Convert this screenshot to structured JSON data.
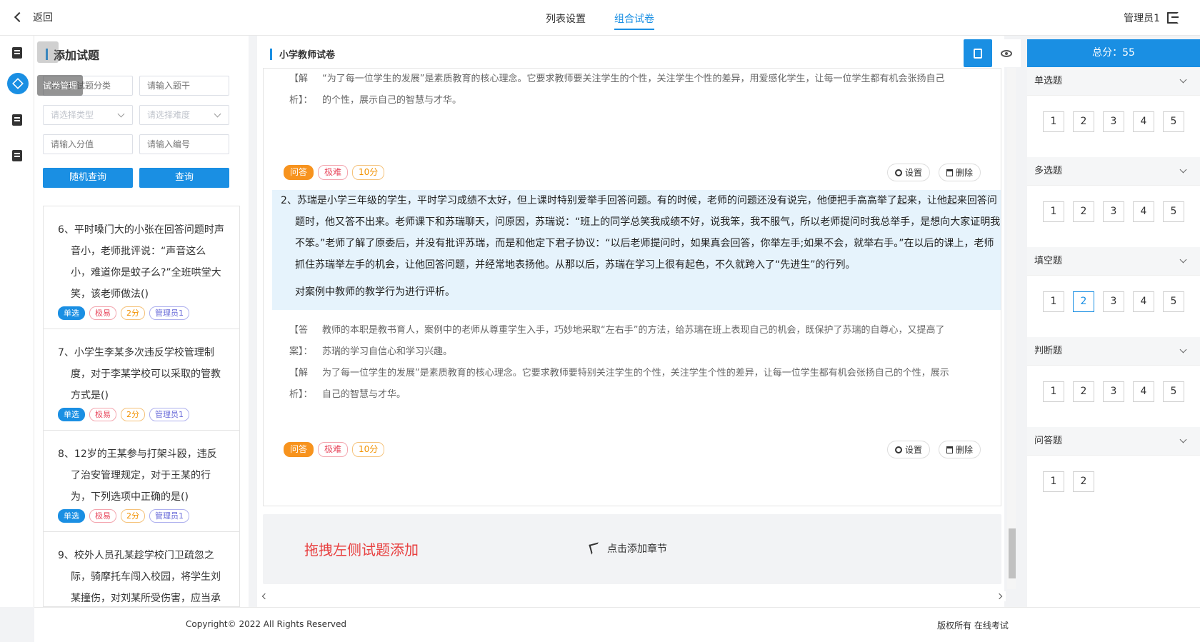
{
  "header": {
    "back_label": "返回",
    "tabs": [
      {
        "label": "列表设置",
        "active": false
      },
      {
        "label": "组合试卷",
        "active": true
      }
    ],
    "user": "管理员1"
  },
  "iconbar": {
    "tooltip": "试卷管理"
  },
  "left": {
    "title": "添加试题",
    "fields": {
      "category_placeholder": "请选择试题分类",
      "stem_placeholder": "请输入题干",
      "type_placeholder": "请选择类型",
      "difficulty_placeholder": "请选择难度",
      "score_placeholder": "请输入分值",
      "number_placeholder": "请输入编号"
    },
    "random_btn": "随机查询",
    "query_btn": "查询",
    "questions": [
      {
        "text": "6、平时嗓门大的小张在回答问题时声音小，老师批评说：“声音这么小，难道你是蚊子么?”全班哄堂大笑，该老师做法()",
        "type": "单选",
        "difficulty": "极易",
        "score": "2分",
        "author": "管理员1"
      },
      {
        "text": "7、小学生李某多次违反学校管理制度，对于李某学校可以采取的管教方式是()",
        "type": "单选",
        "difficulty": "极易",
        "score": "2分",
        "author": "管理员1"
      },
      {
        "text": "8、12岁的王某参与打架斗殴，违反了治安管理规定，对于王某的行为，下列选项中正确的是()",
        "type": "单选",
        "difficulty": "极易",
        "score": "2分",
        "author": "管理员1"
      },
      {
        "text": "9、校外人员孔某趁学校门卫疏忽之际，骑摩托车闯入校园，将学生刘某撞伤，对刘某所受伤害，应当承",
        "type": "",
        "difficulty": "",
        "score": "",
        "author": ""
      }
    ]
  },
  "center": {
    "title": "小学教师试卷",
    "card1": {
      "analysis_label": "【解析】：",
      "analysis": "“为了每一位学生的发展”是素质教育的核心理念。它要求教师要关注学生的个性，关注学生个性的差异，用爱感化学生，让每一位学生都有机会张扬自己的个性，展示自己的智慧与才华。",
      "type": "问答",
      "difficulty": "极难",
      "score": "10分",
      "settings": "设置",
      "delete": "删除"
    },
    "card2": {
      "question": "2、苏瑞是小学三年级的学生，平时学习成绩不太好，但上课时特别爱举手回答问题。有的时候，老师的问题还没有说完，他便把手高高举了起来，让他起来回答问题时，他又答不出来。老师课下和苏瑞聊天，问原因，苏瑞说：“班上的同学总笑我成绩不好，说我笨，我不服气，所以老师提问时我总举手，是想向大家证明我不笨。”老师了解了原委后，并没有批评苏瑞，而是和他定下君子协议：“以后老师提问时，如果真会回答，你举左手;如果不会，就举右手。”在以后的课上，老师抓住苏瑞举左手的机会，让他回答问题，并经常地表扬他。从那以后，苏瑞在学习上很有起色，不久就跨入了“先进生”的行列。",
      "question_tail": "对案例中教师的教学行为进行评析。",
      "answer_label": "【答案】：",
      "answer": "教师的本职是教书育人，案例中的老师从尊重学生入手，巧妙地采取“左右手”的方法，给苏瑞在班上表现自己的机会，既保护了苏瑞的自尊心，又提高了苏瑞的学习自信心和学习兴趣。",
      "analysis_label": "【解析】：",
      "analysis": "为了每一位学生的发展”是素质教育的核心理念。它要求教师要特别关注学生的个性，关注学生个性的差异，让每一位学生都有机会张扬自己的个性，展示自己的智慧与才华。",
      "type": "问答",
      "difficulty": "极难",
      "score": "10分",
      "settings": "设置",
      "delete": "删除"
    },
    "drop_hint": "拖拽左侧试题添加",
    "add_chapter": "点击添加章节"
  },
  "right": {
    "total": "总分：55",
    "sections": [
      {
        "name": "单选题",
        "numbers": [
          "1",
          "2",
          "3",
          "4",
          "5"
        ],
        "selected": ""
      },
      {
        "name": "多选题",
        "numbers": [
          "1",
          "2",
          "3",
          "4",
          "5"
        ],
        "selected": ""
      },
      {
        "name": "填空题",
        "numbers": [
          "1",
          "2",
          "3",
          "4",
          "5"
        ],
        "selected": "2"
      },
      {
        "name": "判断题",
        "numbers": [
          "1",
          "2",
          "3",
          "4",
          "5"
        ],
        "selected": ""
      },
      {
        "name": "问答题",
        "numbers": [
          "1",
          "2"
        ],
        "selected": ""
      }
    ]
  },
  "footer": {
    "copyright": "Copyright© 2022 All Rights Reserved",
    "rights": "版权所有 在线考试"
  },
  "colors": {
    "accent": "#1a8fe3",
    "danger": "#e84040",
    "highlight": "#e6f3fc"
  }
}
